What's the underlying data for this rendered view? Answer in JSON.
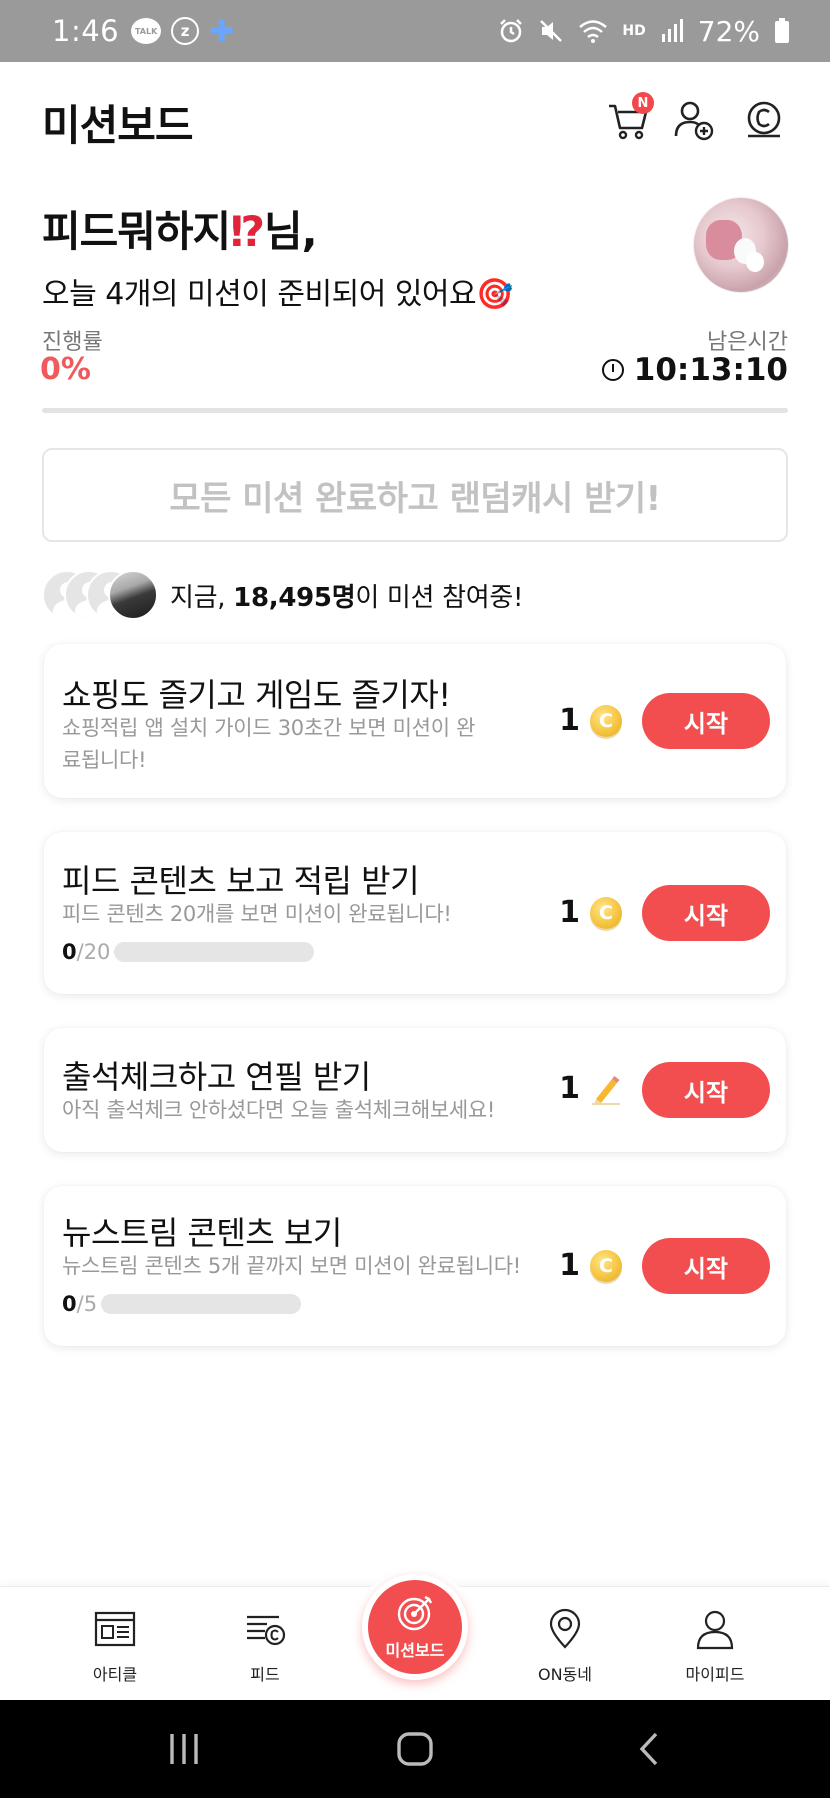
{
  "status_bar": {
    "time": "1:46",
    "left_icons": [
      "kakaotalk-icon",
      "z-app-icon",
      "plus-app-icon"
    ],
    "talk_text": "TALK",
    "z_text": "z",
    "hd_text": "HD",
    "battery": "72%",
    "right_icons": [
      "alarm-icon",
      "mute-icon",
      "wifi-icon",
      "hd-voice-icon",
      "signal-icon",
      "battery-icon"
    ]
  },
  "header": {
    "title": "미션보드",
    "cart_badge": "N",
    "icons": [
      "cart-icon",
      "add-friend-icon",
      "coin-icon"
    ]
  },
  "greeting": {
    "name": "피드뭐하지",
    "name_emoji": "⁉",
    "suffix": "님,",
    "subtitle": "오늘 4개의 미션이 준비되어 있어요🎯"
  },
  "progress": {
    "label": "진행률",
    "value": "0%"
  },
  "remaining": {
    "label": "남은시간",
    "value": "10:13:10"
  },
  "all_complete_button": "모든 미션 완료하고 랜덤캐시 받기!",
  "participants": {
    "prefix": "지금, ",
    "count": "18,495명",
    "suffix": "이 미션 참여중!"
  },
  "missions": [
    {
      "title": "쇼핑도 즐기고 게임도 즐기자!",
      "description": "쇼핑적립 앱 설치 가이드 30초간 보면 미션이 완료됩니다!",
      "reward": "1",
      "reward_icon": "coin-icon",
      "button": "시작"
    },
    {
      "title": "피드 콘텐츠 보고 적립 받기",
      "description": "피드 콘텐츠 20개를 보면 미션이 완료됩니다!",
      "progress_current": "0",
      "progress_total": "/20",
      "progress_fraction": 0,
      "reward": "1",
      "reward_icon": "coin-icon",
      "button": "시작"
    },
    {
      "title": "출석체크하고 연필 받기",
      "description": "아직 출석체크 안하셨다면 오늘 출석체크해보세요!",
      "reward": "1",
      "reward_icon": "pencil-icon",
      "button": "시작"
    },
    {
      "title": "뉴스트림 콘텐츠 보기",
      "description": "뉴스트림 콘텐츠 5개 끝까지 보면 미션이 완료됩니다!",
      "progress_current": "0",
      "progress_total": "/5",
      "progress_fraction": 0,
      "reward": "1",
      "reward_icon": "coin-icon",
      "button": "시작"
    }
  ],
  "coin_symbol": "C",
  "bottom_nav": {
    "items": [
      {
        "label": "아티클",
        "icon": "article-icon"
      },
      {
        "label": "피드",
        "icon": "feed-icon"
      },
      {
        "label": "미션보드",
        "icon": "target-icon",
        "active": true
      },
      {
        "label": "ON동네",
        "icon": "location-icon"
      },
      {
        "label": "마이피드",
        "icon": "profile-icon"
      }
    ]
  },
  "system_nav": [
    "recents-icon",
    "home-icon",
    "back-icon"
  ],
  "colors": {
    "accent": "#f24e50",
    "progress_text": "#f05a5d",
    "status_bar": "#9a9a9a",
    "coin": "#f5c542"
  }
}
